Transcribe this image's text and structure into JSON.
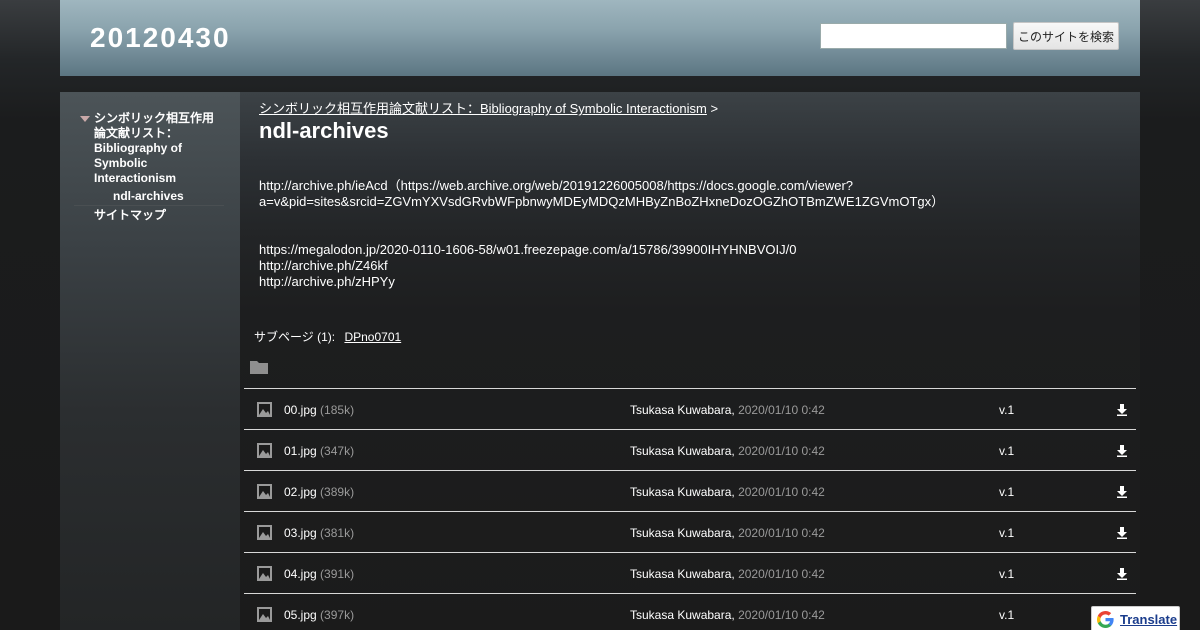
{
  "header": {
    "site_title": "20120430",
    "search_placeholder": "",
    "search_button": "このサイトを検索"
  },
  "sidebar": {
    "items": [
      {
        "label_lines": [
          "シンボリック相互作用",
          "論文献リスト：",
          "Bibliography of",
          "Symbolic",
          "Interactionism"
        ]
      },
      {
        "label": "ndl-archives"
      },
      {
        "label": "サイトマップ"
      }
    ]
  },
  "main": {
    "breadcrumb_link": "シンボリック相互作用論文献リスト：Bibliography of Symbolic Interactionism",
    "breadcrumb_sep": ">",
    "title": "ndl-archives",
    "paragraph1_line1": "http://archive.ph/ieAcd（https://web.archive.org/web/20191226005008/https://docs.google.com/viewer?",
    "paragraph1_line2": "a=v&pid=sites&srcid=ZGVmYXVsdGRvbWFpbnwyMDEyMDQzMHByZnBoZHxneDozOGZhOTBmZWE1ZGVmOTgx）",
    "paragraph2_line1": "https://megalodon.jp/2020-0110-1606-58/w01.freezepage.com/a/15786/39900IHYHNBVOIJ/0",
    "paragraph2_line2": "http://archive.ph/Z46kf",
    "paragraph2_line3": "http://archive.ph/zHPYy",
    "subpages_label": "サブページ (1):",
    "subpage_link": "DPno0701"
  },
  "files": [
    {
      "name": "00.jpg",
      "size": "(185k)",
      "author": "Tsukasa Kuwabara,",
      "date": "2020/01/10 0:42",
      "version": "v.1"
    },
    {
      "name": "01.jpg",
      "size": "(347k)",
      "author": "Tsukasa Kuwabara,",
      "date": "2020/01/10 0:42",
      "version": "v.1"
    },
    {
      "name": "02.jpg",
      "size": "(389k)",
      "author": "Tsukasa Kuwabara,",
      "date": "2020/01/10 0:42",
      "version": "v.1"
    },
    {
      "name": "03.jpg",
      "size": "(381k)",
      "author": "Tsukasa Kuwabara,",
      "date": "2020/01/10 0:42",
      "version": "v.1"
    },
    {
      "name": "04.jpg",
      "size": "(391k)",
      "author": "Tsukasa Kuwabara,",
      "date": "2020/01/10 0:42",
      "version": "v.1"
    },
    {
      "name": "05.jpg",
      "size": "(397k)",
      "author": "Tsukasa Kuwabara,",
      "date": "2020/01/10 0:42",
      "version": "v.1"
    }
  ],
  "translate": {
    "label": "Translate",
    "icon": "google-g-icon"
  },
  "colors": {
    "header_top": "#9fb6bf",
    "header_bottom": "#5c7682",
    "nav_arrow": "#c9a9a9",
    "muted_text": "#9a9a9a",
    "translate_link": "#1a3c8c"
  }
}
